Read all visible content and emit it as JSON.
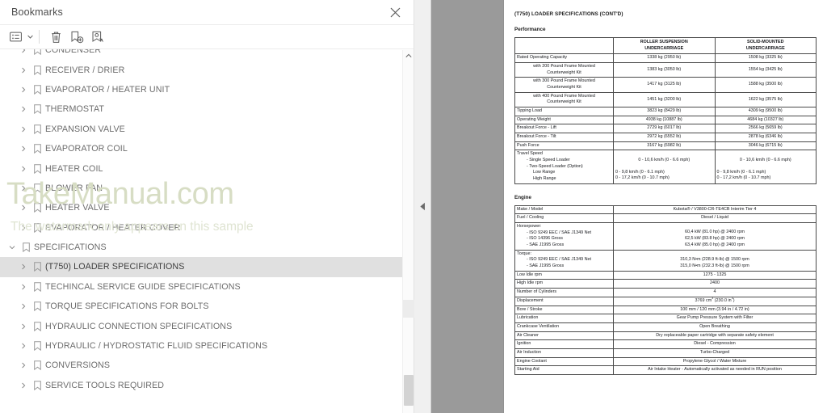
{
  "sidebar": {
    "title": "Bookmarks",
    "close_icon": "close-icon",
    "toolbar": {
      "list_options_label": "list-options-icon",
      "delete_label": "trash-icon",
      "new_bookmark_label": "add-bookmark-icon",
      "edit_bookmark_label": "edit-bookmark-icon"
    },
    "items": [
      {
        "label": "CONDENSER",
        "level": 2,
        "expanded": false,
        "selected": false
      },
      {
        "label": "RECEIVER / DRIER",
        "level": 2,
        "expanded": false,
        "selected": false
      },
      {
        "label": "EVAPORATOR / HEATER UNIT",
        "level": 2,
        "expanded": false,
        "selected": false
      },
      {
        "label": "THERMOSTAT",
        "level": 2,
        "expanded": false,
        "selected": false
      },
      {
        "label": "EXPANSION VALVE",
        "level": 2,
        "expanded": false,
        "selected": false
      },
      {
        "label": "EVAPORATOR COIL",
        "level": 2,
        "expanded": false,
        "selected": false
      },
      {
        "label": "HEATER COIL",
        "level": 2,
        "expanded": false,
        "selected": false
      },
      {
        "label": "BLOWER FAN",
        "level": 2,
        "expanded": false,
        "selected": false
      },
      {
        "label": "HEATER VALVE",
        "level": 2,
        "expanded": false,
        "selected": false
      },
      {
        "label": "EVAPORATOR / HEATER COVER",
        "level": 2,
        "expanded": false,
        "selected": false
      },
      {
        "label": "SPECIFICATIONS",
        "level": 1,
        "expanded": true,
        "selected": false
      },
      {
        "label": "(T750) LOADER SPECIFICATIONS",
        "level": 2,
        "expanded": false,
        "selected": true
      },
      {
        "label": "TECHINCAL SERVICE GUIDE SPECIFICATIONS",
        "level": 2,
        "expanded": false,
        "selected": false
      },
      {
        "label": "TORQUE SPECIFICATIONS FOR BOLTS",
        "level": 2,
        "expanded": false,
        "selected": false
      },
      {
        "label": "HYDRAULIC CONNECTION SPECIFICATIONS",
        "level": 2,
        "expanded": false,
        "selected": false
      },
      {
        "label": "HYDRAULIC / HYDROSTATIC FLUID SPECIFICATIONS",
        "level": 2,
        "expanded": false,
        "selected": false
      },
      {
        "label": "CONVERSIONS",
        "level": 2,
        "expanded": false,
        "selected": false
      },
      {
        "label": "SERVICE TOOLS REQUIRED",
        "level": 2,
        "expanded": false,
        "selected": false
      }
    ]
  },
  "watermark": {
    "main": "TakeManual.com",
    "sub": "The watermark only appears on this sample",
    "color": "#d7ddc4"
  },
  "document": {
    "title": "(T750) LOADER SPECIFICATIONS (CONT'D)",
    "performance": {
      "heading": "Performance",
      "columns": [
        "",
        "ROLLER SUSPENSION UNDERCARRIAGE",
        "SOLID-MOUNTED UNDERCARRIAGE"
      ],
      "col2_line1": "ROLLER SUSPENSION",
      "col2_line2": "UNDERCARRIAGE",
      "col3_line1": "SOLID-MOUNTED",
      "col3_line2": "UNDERCARRIAGE",
      "rows": [
        {
          "label": "Rated Operating Capacity",
          "indent": 0,
          "roller": "1338 kg (2950 lb)",
          "solid": "1508 kg (3325 lb)"
        },
        {
          "label": "with 200 Pound Frame Mounted",
          "label2": "Counterweight Kit",
          "indent": 1,
          "roller": "1383 kg (3050 lb)",
          "solid": "1554 kg (3425 lb)"
        },
        {
          "label": "with 300 Pound Frame Mounted",
          "label2": "Counterweight Kit",
          "indent": 1,
          "roller": "1417 kg (3125 lb)",
          "solid": "1588 kg (3500 lb)"
        },
        {
          "label": "with 400 Pound Frame Mounted",
          "label2": "Counterweight Kit",
          "indent": 1,
          "roller": "1451 kg (3200 lb)",
          "solid": "1622 kg (3575 lb)"
        },
        {
          "label": "Tipping Load",
          "indent": 0,
          "roller": "3823 kg (8429 lb)",
          "solid": "4309 kg (9500 lb)"
        },
        {
          "label": "Operating Weight",
          "indent": 0,
          "roller": "4938 kg (10887 lb)",
          "solid": "4684 kg (10327 lb)"
        },
        {
          "label": "Breakout Force - Lift",
          "indent": 0,
          "roller": "2729 kg (6017 lb)",
          "solid": "2566 kg (5659 lb)"
        },
        {
          "label": "Breakout Force - Tilt",
          "indent": 0,
          "roller": "2972 kg (6552 lb)",
          "solid": "2878 kg (6346 lb)"
        },
        {
          "label": "Push Force",
          "indent": 0,
          "roller": "3167 kg (6982 lb)",
          "solid": "3046 kg (6715 lb)"
        }
      ],
      "travel_speed": {
        "label_l1": "Travel Speed",
        "label_l2": "- Single Speed Loader",
        "label_l3": "- Two-Speed Loader (Option)",
        "label_l4": "Low Range",
        "label_l5": "High Range",
        "roller_single": "0 - 10,6 km/h (0 - 6.6 mph)",
        "solid_single": "0 - 10,6 km/h (0 - 6.6 mph)",
        "roller_low": "0 - 9,8 km/h (0 - 6.1 mph)",
        "roller_high": "0 - 17,2 km/h (0 - 10.7 mph)",
        "solid_low": "0 - 9,8 km/h (0 - 6.1 mph)",
        "solid_high": "0 - 17,2 km/h (0 - 10.7 mph)"
      }
    },
    "engine": {
      "heading": "Engine",
      "rows": [
        {
          "label": "Make / Model",
          "value": "Kubota® / V3800-CR-TE4CB Interim Tier 4"
        },
        {
          "label": "Fuel / Cooling",
          "value": "Diesel / Liquid"
        },
        {
          "label": "Low Idle rpm",
          "value": "1275 - 1325"
        },
        {
          "label": "High Idle rpm",
          "value": "2400"
        },
        {
          "label": "Number of Cylinders",
          "value": "4"
        },
        {
          "label": "Bore / Stroke",
          "value": "100 mm / 120 mm (3.94 in / 4.72 in)"
        },
        {
          "label": "Lubrication",
          "value": "Gear Pump Pressure System with Filter"
        },
        {
          "label": "Crankcase Ventilation",
          "value": "Open Breathing"
        },
        {
          "label": "Air Cleaner",
          "value": "Dry replaceable paper cartridge with separate safety element"
        },
        {
          "label": "Ignition",
          "value": "Diesel - Compression"
        },
        {
          "label": "Air Induction",
          "value": "Turbo-Charged"
        },
        {
          "label": "Engine Coolant",
          "value": "Propylene Glycol / Water Mixture"
        },
        {
          "label": "Starting Aid",
          "value": "Air Intake Heater - Automatically activated as needed in RUN position"
        }
      ],
      "horsepower": {
        "label_l1": "Horsepower:",
        "label_l2": "- ISO 9249 EEC / SAE J1349 Net",
        "label_l3": "- ISO 14396 Gross",
        "label_l4": "- SAE J1995 Gross",
        "value_l2": "60,4 kW (81.0 hp) @ 2400 rpm",
        "value_l3": "62,5 kW (83.8 hp) @ 2400 rpm",
        "value_l4": "63,4 kW (85.0 hp) @ 2400 rpm"
      },
      "torque": {
        "label_l1": "Torque:",
        "label_l2": "- ISO 9249 EEC / SAE J1349 Net",
        "label_l3": "- SAE J1995 Gross",
        "value_l2": "310,3 N•m (228.9 ft-lb) @ 1500 rpm",
        "value_l3": "315,0 N•m (232.3 ft-lb) @ 1500 rpm"
      },
      "displacement": {
        "label": "Displacement",
        "value_metric_num": "3769 cm",
        "value_metric_sup": "3",
        "value_imp_num": " (230.0 in",
        "value_imp_sup": "3",
        "value_tail": ")"
      }
    }
  }
}
